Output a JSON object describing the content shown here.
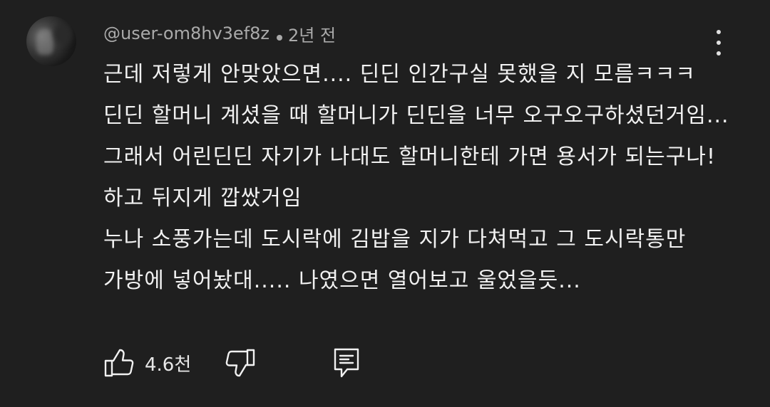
{
  "comment": {
    "author": "@user-om8hv3ef8z",
    "timestamp": "2년 전",
    "lines": [
      "근데 저렇게 안맞았으면.... 딘딘 인간구실 못했을 지 모름ㅋㅋㅋ",
      "딘딘 할머니 계셨을 때 할머니가 딘딘을 너무 오구오구하셨던거임...",
      "그래서 어린딘딘 자기가 나대도 할머니한테 가면 용서가 되는구나!",
      "하고 뒤지게 깝쌌거임",
      "누나 소풍가는데 도시락에 김밥을 지가 다쳐먹고 그 도시락통만",
      "가방에 넣어놨대..... 나였으면 열어보고 울었을듯..."
    ],
    "like_count": "4.6천"
  },
  "icons": {
    "menu": "more-vert-icon",
    "like": "thumbs-up-icon",
    "dislike": "thumbs-down-icon",
    "reply": "reply-comment-icon"
  },
  "colors": {
    "background": "#1f1f1f",
    "text": "#f1f1f1",
    "meta": "#aaaaaa"
  }
}
